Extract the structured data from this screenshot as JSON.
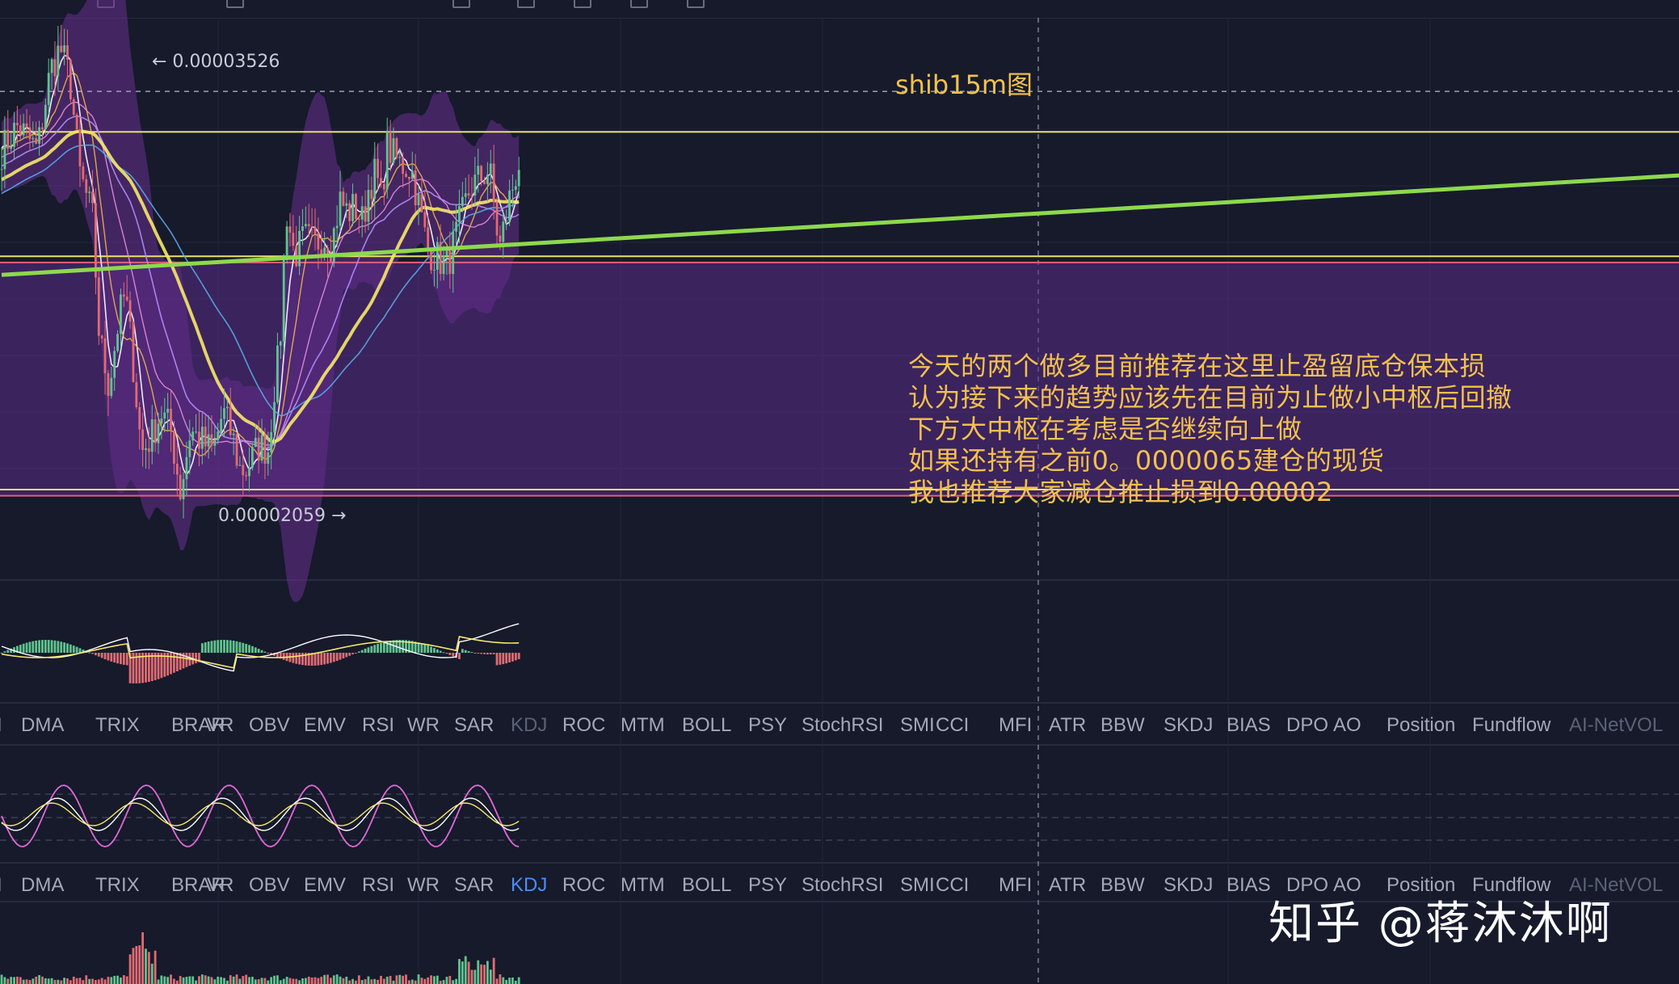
{
  "chart_data": {
    "type": "candlestick",
    "title": "shib15m图",
    "price_range": [
      2e-05,
      3.6e-05
    ],
    "price_high_label": "← 0.00003526",
    "price_low_label": "0.00002059 →",
    "price_high": 3.526e-05,
    "price_low": 2.059e-05,
    "horizontal_levels": [
      {
        "price": 3.28e-05,
        "color": "#e8e36a"
      },
      {
        "price": 2.88e-05,
        "color": "#e8e36a"
      },
      {
        "price": 2.86e-05,
        "color": "#e0607a"
      },
      {
        "price": 2.13e-05,
        "color": "#e8e36a"
      },
      {
        "price": 2.11e-05,
        "color": "#e0607a"
      }
    ],
    "dashed_level_price": 3.41e-05,
    "trendline": {
      "start": [
        0,
        2.82e-05
      ],
      "end": [
        220,
        3.14e-05
      ],
      "color": "#8dd94c"
    },
    "annotation_lines": [
      "今天的两个做多目前推荐在这里止盈留底仓保本损",
      "认为接下来的趋势应该先在目前为止做小中枢后回撤",
      "下方大中枢在考虑是否继续向上做",
      "如果还持有之前0。0000065建仓的现货",
      "我也推荐大家减仓推止损到0.00002"
    ]
  },
  "indicator_tabs": [
    "I",
    "DMA",
    "TRIX",
    "BRAR",
    "VR",
    "OBV",
    "EMV",
    "RSI",
    "WR",
    "SAR",
    "KDJ",
    "ROC",
    "MTM",
    "BOLL",
    "PSY",
    "StochRSI",
    "SMI",
    "CCI",
    "MFI",
    "ATR",
    "BBW",
    "SKDJ",
    "BIAS",
    "DPO",
    "AO",
    "Position",
    "Fundflow",
    "AI-NetVOL"
  ],
  "panel1_active_tab": "",
  "panel2_active_tab": "KDJ",
  "watermark": "知乎 @蒋沐沐啊",
  "colors": {
    "background": "#161a2b",
    "up": "#5fc48f",
    "down": "#e06b73",
    "band": "#6a2f8f",
    "ma_yellow": "#f7e86a",
    "trend_green": "#8dd94c"
  }
}
